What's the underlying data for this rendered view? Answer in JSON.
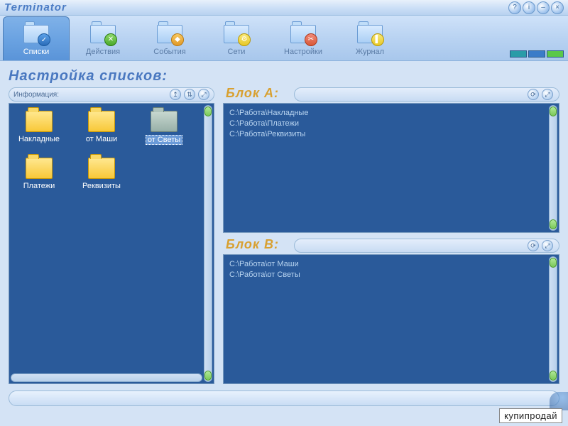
{
  "app": {
    "title": "Terminator"
  },
  "toolbar": {
    "tabs": [
      {
        "label": "Списки",
        "active": true,
        "badge": "blue",
        "glyph": "✓"
      },
      {
        "label": "Действия",
        "active": false,
        "badge": "green",
        "glyph": "✕"
      },
      {
        "label": "События",
        "active": false,
        "badge": "orange",
        "glyph": "◆"
      },
      {
        "label": "Сети",
        "active": false,
        "badge": "yellow",
        "glyph": "⚙"
      },
      {
        "label": "Настройки",
        "active": false,
        "badge": "red",
        "glyph": "✂"
      },
      {
        "label": "Журнал",
        "active": false,
        "badge": "yellow",
        "glyph": "▌"
      }
    ]
  },
  "page": {
    "title": "Настройка списков:"
  },
  "infoPanel": {
    "label": "Информация:",
    "folders": [
      {
        "name": "Накладные",
        "style": "y",
        "selected": false
      },
      {
        "name": "от Маши",
        "style": "y",
        "selected": false
      },
      {
        "name": "от Светы",
        "style": "g",
        "selected": true
      },
      {
        "name": "Платежи",
        "style": "y",
        "selected": false
      },
      {
        "name": "Реквизиты",
        "style": "y",
        "selected": false
      }
    ]
  },
  "blockA": {
    "title": "Блок A:",
    "paths": [
      "C:\\Работа\\Накладные",
      "C:\\Работа\\Платежи",
      "C:\\Работа\\Реквизиты"
    ]
  },
  "blockB": {
    "title": "Блок B:",
    "paths": [
      "C:\\Работа\\от Маши",
      "C:\\Работа\\от Светы"
    ]
  },
  "icons": {
    "help": "?",
    "info": "i",
    "min": "–",
    "close": "×",
    "up": "↥",
    "updown": "⇅",
    "expand": "⤢",
    "refresh": "⟳",
    "expand2": "⤢"
  },
  "watermark": "купипродай"
}
